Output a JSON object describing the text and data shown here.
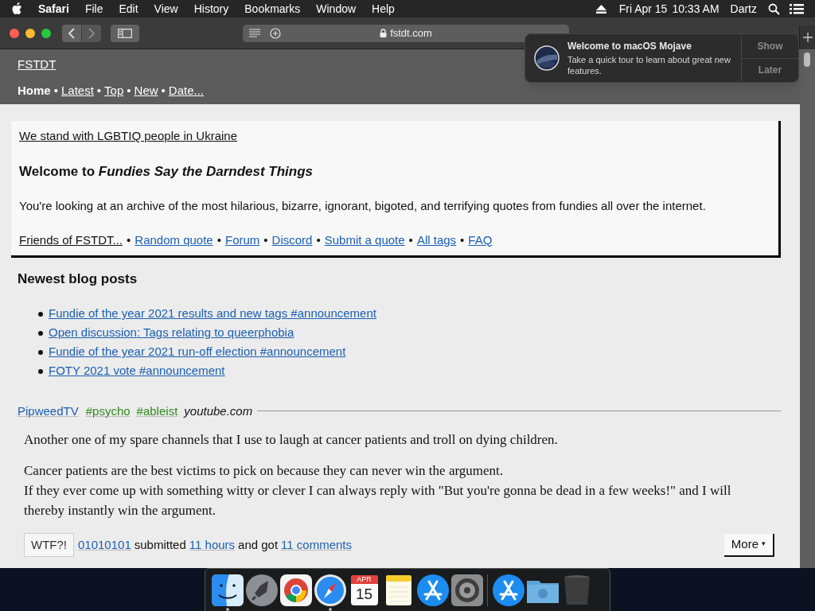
{
  "menu_bar": {
    "app": "Safari",
    "menus": [
      "File",
      "Edit",
      "View",
      "History",
      "Bookmarks",
      "Window",
      "Help"
    ],
    "date": "Fri Apr 15",
    "time": "10:33 AM",
    "user": "Dartz"
  },
  "toolbar": {
    "url": "fstdt.com"
  },
  "notification": {
    "title": "Welcome to macOS Mojave",
    "body": "Take a quick tour to learn about great new features.",
    "actions": [
      "Show",
      "Later"
    ]
  },
  "site": {
    "title": "FSTDT",
    "separator": "•",
    "nav": [
      {
        "label": "Home",
        "selected": true
      },
      {
        "label": "Latest",
        "selected": false
      },
      {
        "label": "Top",
        "selected": false
      },
      {
        "label": "New",
        "selected": false
      },
      {
        "label": "Date...",
        "selected": false
      }
    ]
  },
  "banner": {
    "separator": "•",
    "notice": "We stand with LGBTIQ people in Ukraine",
    "heading": "Welcome to *Fundies Say the Darndest Things*",
    "intro": "You're looking at an archive of the most hilarious, bizarre, ignorant, bigoted, and terrifying quotes from fundies all over the internet.",
    "links": [
      {
        "label": "Friends of FSTDT...",
        "kind": "menu"
      },
      {
        "label": "Random quote",
        "kind": "link"
      },
      {
        "label": "Forum",
        "kind": "link"
      },
      {
        "label": "Discord",
        "kind": "link"
      },
      {
        "label": "Submit a quote",
        "kind": "link"
      },
      {
        "label": "All tags",
        "kind": "link"
      },
      {
        "label": "FAQ",
        "kind": "link"
      }
    ]
  },
  "blog": {
    "heading": "Newest blog posts",
    "posts": [
      "Fundie of the year 2021 results and new tags #announcement",
      "Open discussion: Tags relating to queerphobia",
      "Fundie of the year 2021 run-off election #announcement",
      "FOTY 2021 vote #announcement"
    ]
  },
  "quote": {
    "author": "PipweedTV",
    "tags": [
      "#psycho",
      "#ableist"
    ],
    "source": "youtube.com",
    "paragraphs": [
      [
        "Another one of my spare channels that I use to laugh at cancer patients and troll on dying children."
      ],
      [
        "Cancer patients are the best victims to pick on because they can never win the argument.",
        "If they ever come up with something witty or clever I can always reply with \"But you're gonna be dead in a few weeks!\" and I will thereby instantly win the argument."
      ]
    ],
    "reaction": "WTF?!",
    "submitter": "01010101",
    "submitted": "submitted",
    "age": "11 hours",
    "got": "and got",
    "comments": "11 comments",
    "more": "More",
    "more_caret": "▾"
  },
  "dock": {
    "calendar_month": "APR",
    "calendar_day": "15",
    "apps": [
      {
        "kind": "finder",
        "running": true
      },
      {
        "kind": "launchpad",
        "running": false
      },
      {
        "kind": "chrome",
        "running": false
      },
      {
        "kind": "safari",
        "running": true
      },
      {
        "kind": "calendar",
        "running": false
      },
      {
        "kind": "notes",
        "running": false
      },
      {
        "kind": "appstore",
        "running": false
      },
      {
        "kind": "settings",
        "running": false
      },
      {
        "kind": "separator"
      },
      {
        "kind": "appstore",
        "running": false
      },
      {
        "kind": "folder",
        "running": false
      },
      {
        "kind": "trash",
        "running": false
      }
    ]
  }
}
